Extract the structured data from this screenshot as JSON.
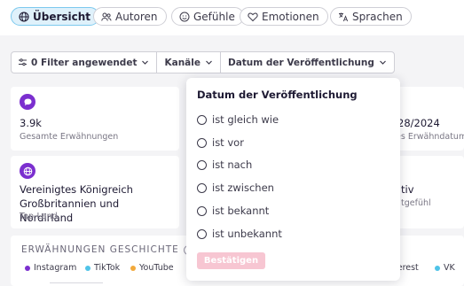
{
  "tabs": [
    {
      "label": "Übersicht",
      "icon": "globe-icon",
      "active": true
    },
    {
      "label": "Autoren",
      "icon": "people-icon"
    },
    {
      "label": "Gefühle",
      "icon": "smile-icon"
    },
    {
      "label": "Emotionen",
      "icon": "heart-icon"
    },
    {
      "label": "Sprachen",
      "icon": "translate-icon"
    }
  ],
  "filters": {
    "applied": "0 Filter angewendet",
    "channels": "Kanäle",
    "pubdate": "Datum der Veröffentlichung"
  },
  "cards": {
    "mentions": {
      "value": "3.9k",
      "label": "Gesamte Erwähnungen"
    },
    "date": {
      "value": "28/2024",
      "label": "es Erwähndatum"
    },
    "country": {
      "value": "Vereinigtes Königreich Großbritannien und Nordirland",
      "label": "Top-Land"
    },
    "sentiment": {
      "value": "tiv",
      "label": "tgefühl"
    }
  },
  "history": {
    "title": "ERWÄHNUNGEN GESCHICHTE",
    "help": "?",
    "legend": [
      {
        "label": "Instagram",
        "color": "#7b2fcf"
      },
      {
        "label": "TikTok",
        "color": "#4fc3e8"
      },
      {
        "label": "YouTube",
        "color": "#f2a93b"
      },
      {
        "label": "terest",
        "color": "#4fc3e8"
      },
      {
        "label": "VK",
        "color": "#4fc3e8"
      }
    ]
  },
  "popover": {
    "title": "Datum der Veröffentlichung",
    "options": [
      "ist gleich wie",
      "ist vor",
      "ist nach",
      "ist zwischen",
      "ist bekannt",
      "ist unbekannt"
    ],
    "confirm": "Bestätigen"
  },
  "colors": {
    "accent": "#7b2fcf",
    "active_tab_bg": "#dff1fb",
    "confirm_disabled": "#f7c6d2"
  }
}
